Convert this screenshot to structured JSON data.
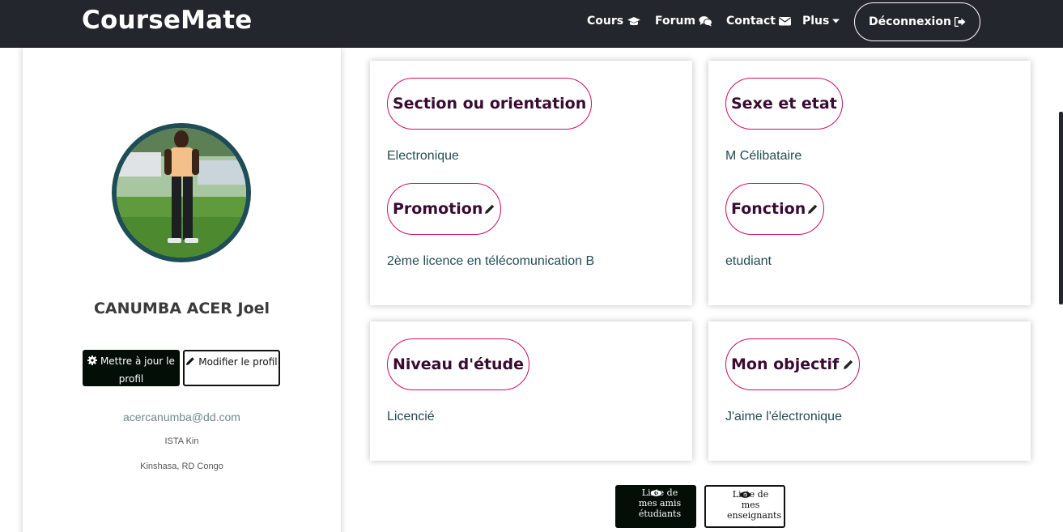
{
  "navbar": {
    "brand": "CourseMate",
    "items": [
      {
        "label": "Cours",
        "icon": "graduation-cap-icon"
      },
      {
        "label": "Forum",
        "icon": "comments-icon"
      },
      {
        "label": "Contact",
        "icon": "envelope-icon"
      },
      {
        "label": "Plus",
        "icon": "caret-down-icon"
      }
    ],
    "logout_label": "Déconnexion",
    "logout_icon": "sign-out-icon",
    "background": "#24262d"
  },
  "profile": {
    "name": "CANUMBA ACER Joel",
    "update_button": "Mettre à jour le profil",
    "modify_button": "Modifier le profil",
    "email": "acercanumba@dd.com",
    "school": "ISTA Kin",
    "location": "Kinshasa, RD Congo"
  },
  "cards": [
    {
      "title": "Section ou orientation",
      "value": "Electronique",
      "editable": false
    },
    {
      "title": "Promotion",
      "value": "2ème licence en télécomunication B",
      "editable": true
    },
    {
      "title": "Sexe et etat",
      "value": "M Célibataire",
      "editable": false
    },
    {
      "title": "Fonction",
      "value": "etudiant",
      "editable": true
    },
    {
      "title": "Niveau d'étude",
      "value": "Licencié",
      "editable": false
    },
    {
      "title": "Mon objectif",
      "value": "J'aime l'électronique",
      "editable": true
    }
  ],
  "footer_buttons": {
    "friends": "Liste de mes amis étudiants",
    "teachers": "Liste de mes enseignants"
  },
  "colors": {
    "accent_pill_border": "#d10a66",
    "pill_text": "#3a0a32",
    "value_text": "#244d55",
    "dark_button": "#020e06",
    "avatar_border": "#1e4d56"
  }
}
